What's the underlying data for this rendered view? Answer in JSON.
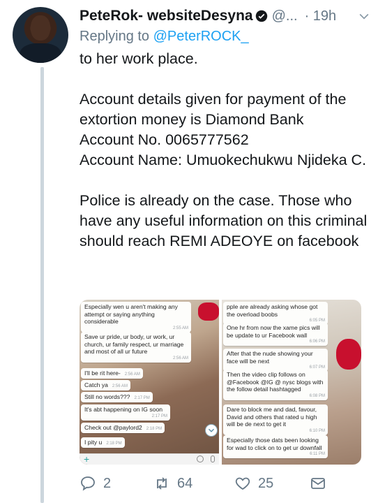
{
  "tweet": {
    "display_name": "PeteRok- websiteDesyna",
    "handle": "@...",
    "time": "· 19h",
    "reply_prefix": "Replying to ",
    "reply_to": "@PeterROCK_",
    "text": "to her work place.\n\nAccount details given for payment of the extortion money is Diamond Bank\nAccount No. 0065777562\nAccount Name: Umuokechukwu Njideka C.\n\nPolice is already on the case. Those who have any useful information on this criminal should reach REMI ADEOYE on facebook"
  },
  "media": {
    "left_chat": [
      {
        "text": "Especially wen u aren't making any attempt or saying anything considerable",
        "time": "2:55 AM"
      },
      {
        "text": "Save ur pride, ur body, ur work, ur church, ur family respect, ur marriage and most of all ur future",
        "time": "2:56 AM"
      },
      {
        "text": "I'll be rit here-",
        "time": "2:56 AM"
      },
      {
        "text": "Catch ya",
        "time": "2:56 AM"
      },
      {
        "text": "Still no words???",
        "time": "2:17 PM"
      },
      {
        "text": "It's abt happening on IG soon",
        "time": "2:17 PM"
      },
      {
        "text": "Check out @paylord2",
        "time": "2:18 PM"
      },
      {
        "text": "I pity u",
        "time": "2:18 PM"
      }
    ],
    "right_chat": [
      {
        "text": "pple are already asking whose got the overload boobs",
        "time": "6:05 PM"
      },
      {
        "text": "One hr from now the xame pics will be update to ur Facebook wall",
        "time": "6:06 PM"
      },
      {
        "text": "After that the nude showing your face will be next",
        "time": "6:07 PM"
      },
      {
        "text": "Then the video clip follows on @Facebook @IG @ nysc blogs with the follow detail hashtagged",
        "time": "6:08 PM"
      },
      {
        "text": "Dare to block me and dad, favour, David and others that rated u high will be de next to get it",
        "time": "6:10 PM"
      },
      {
        "text": "Especially those dats been looking for wad to click on to get ur downfall",
        "time": "6:11 PM"
      }
    ]
  },
  "actions": {
    "replies": "2",
    "retweets": "64",
    "likes": "25"
  },
  "colors": {
    "primary_text": "#14171a",
    "secondary_text": "#657786",
    "link": "#1da1f2",
    "thread_line": "#ccd6dd"
  },
  "icons": [
    "verified-badge-icon",
    "chevron-down-icon",
    "reply-icon",
    "retweet-icon",
    "like-icon",
    "direct-message-icon"
  ]
}
